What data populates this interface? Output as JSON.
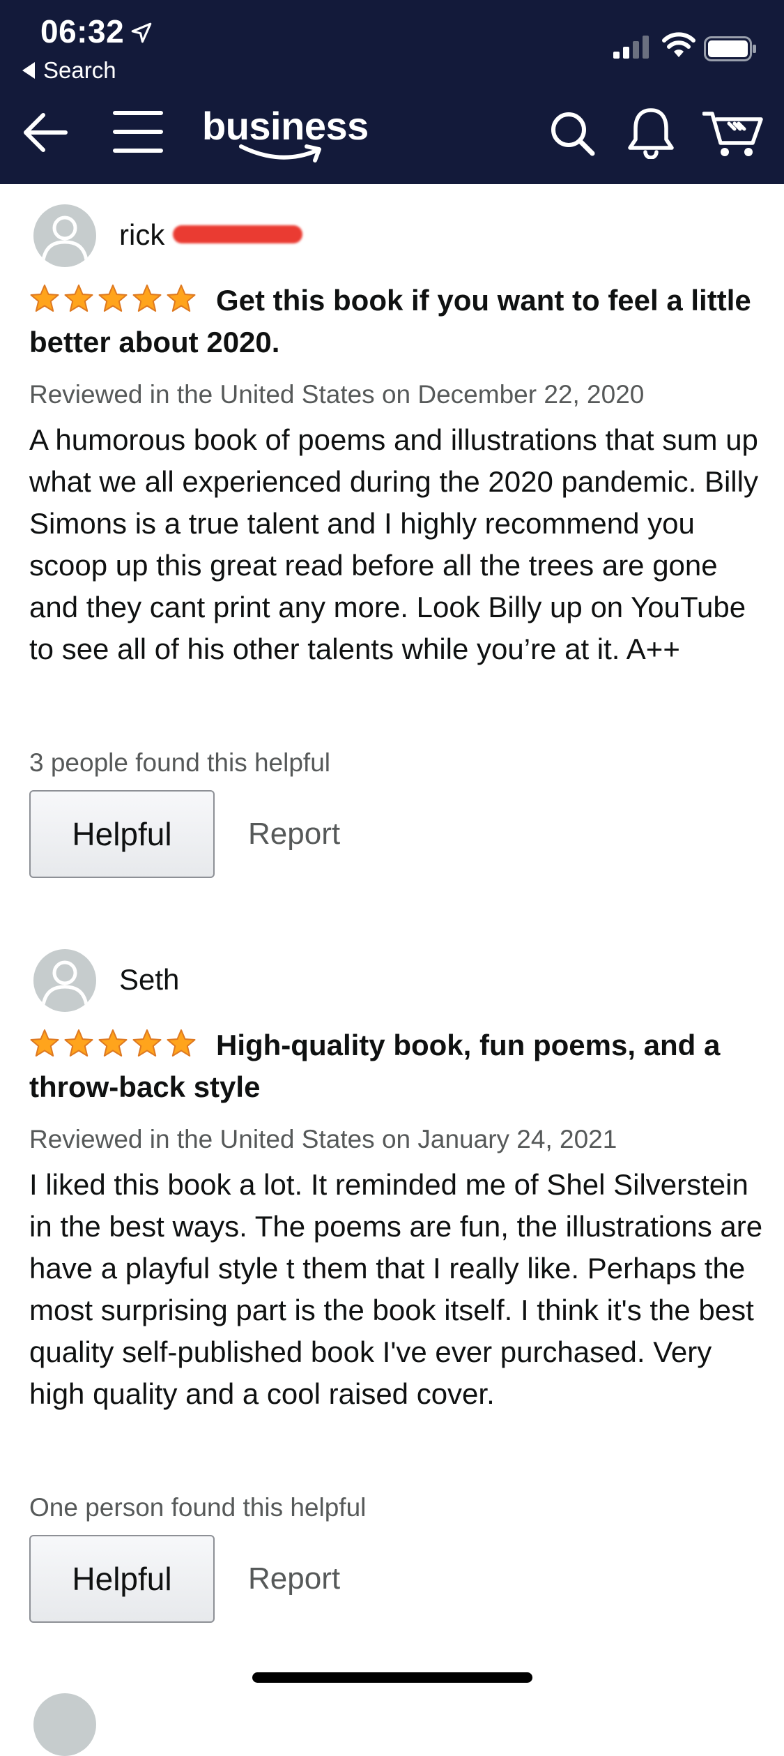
{
  "status_bar": {
    "time": "06:32",
    "back_label": "Search",
    "icons": [
      "location-arrow-icon",
      "cellular-signal-icon",
      "wifi-icon",
      "battery-icon"
    ]
  },
  "nav": {
    "logo_text": "business",
    "icons": [
      "back-arrow-icon",
      "hamburger-menu-icon",
      "search-icon",
      "notification-bell-icon",
      "cart-icon"
    ],
    "background": "#131a3a"
  },
  "reviews": [
    {
      "reviewer": "rick",
      "rating": 5,
      "title": "Get this book if you want to feel a little better about 2020.",
      "meta": "Reviewed in the United States on December 22, 2020",
      "body": "A humorous book of poems and illustrations that sum up what we all experienced during the 2020 pandemic. Billy Simons is a true talent and I highly recommend you scoop up this great read before all the trees are gone and they cant print any more. Look Billy up on YouTube to see all of his other talents while you’re at it. A++",
      "helpful_count": "3 people found this helpful",
      "helpful_label": "Helpful",
      "report_label": "Report"
    },
    {
      "reviewer": "Seth",
      "rating": 5,
      "title": "High-quality book, fun poems, and a throw-back style",
      "meta": "Reviewed in the United States on January 24, 2021",
      "body": "I liked this book a lot. It reminded me of Shel Silverstein in the best ways. The poems are fun, the illustrations are have a playful style t them that I really like. Perhaps the most surprising part is the book itself. I think it's the best quality self-published book I've ever purchased. Very high quality and a cool raised cover.",
      "helpful_count": "One person found this helpful",
      "helpful_label": "Helpful",
      "report_label": "Report"
    }
  ],
  "colors": {
    "star": "#ffa41c",
    "star_outline": "#de7921",
    "meta_text": "#565959",
    "redaction": "#ea3b32"
  }
}
